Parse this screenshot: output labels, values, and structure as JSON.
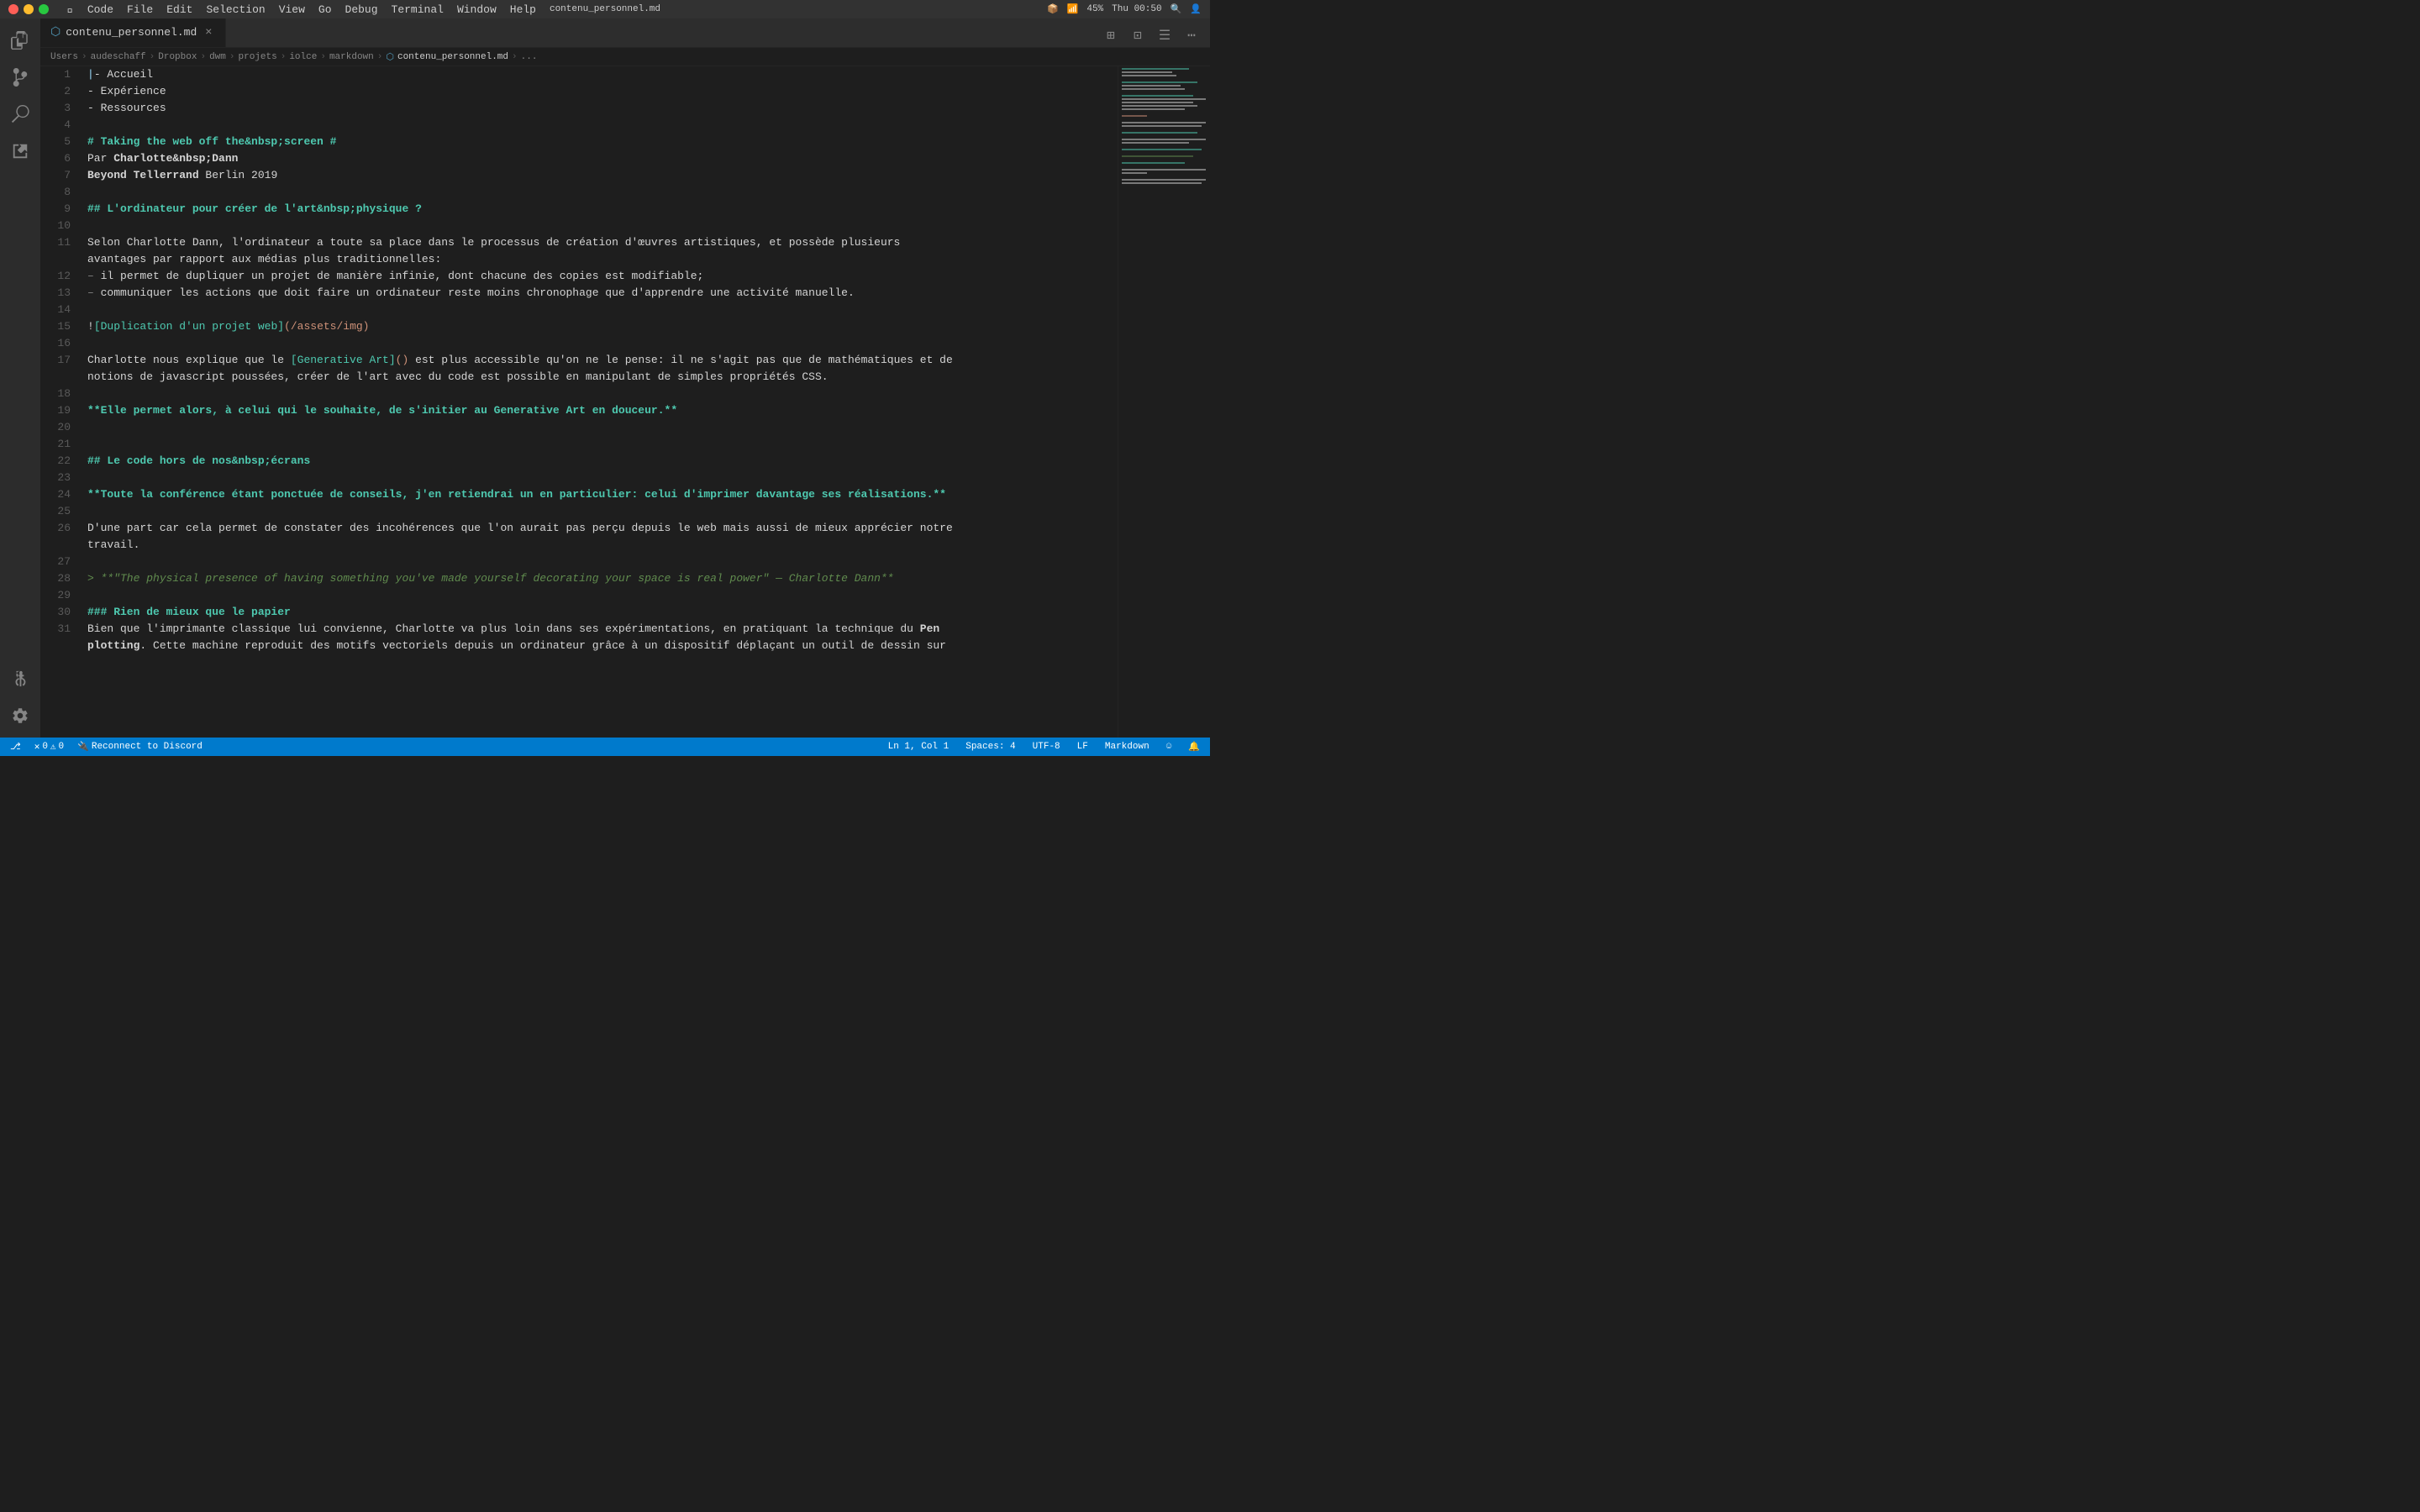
{
  "titlebar": {
    "title": "contenu_personnel.md",
    "menu_items": [
      "",
      "Code",
      "File",
      "Edit",
      "Selection",
      "View",
      "Go",
      "Debug",
      "Terminal",
      "Window",
      "Help"
    ]
  },
  "tab": {
    "name": "contenu_personnel.md",
    "icon": "📄"
  },
  "breadcrumb": {
    "items": [
      "Users",
      "audeschaff",
      "Dropbox",
      "dwm",
      "projets",
      "iolce",
      "markdown",
      "contenu_personnel.md",
      "..."
    ]
  },
  "lines": [
    {
      "num": 1,
      "tokens": [
        {
          "text": "|- Accueil",
          "class": ""
        }
      ]
    },
    {
      "num": 2,
      "tokens": [
        {
          "text": "- Expérience",
          "class": ""
        }
      ]
    },
    {
      "num": 3,
      "tokens": [
        {
          "text": "- Ressources",
          "class": ""
        }
      ]
    },
    {
      "num": 4,
      "tokens": [
        {
          "text": "",
          "class": ""
        }
      ]
    },
    {
      "num": 5,
      "tokens": [
        {
          "text": "# Taking the web off the&nbsp;screen #",
          "class": "c-heading"
        }
      ]
    },
    {
      "num": 6,
      "tokens": [
        {
          "text": "Par **Charlotte&nbsp;Dann**",
          "class": ""
        }
      ]
    },
    {
      "num": 7,
      "tokens": [
        {
          "text": "**Beyond Tellerrand** Berlin 2019",
          "class": ""
        }
      ]
    },
    {
      "num": 8,
      "tokens": [
        {
          "text": "",
          "class": ""
        }
      ]
    },
    {
      "num": 9,
      "tokens": [
        {
          "text": "## L'ordinateur pour créer de l'art&nbsp;physique ?",
          "class": "c-heading"
        }
      ]
    },
    {
      "num": 10,
      "tokens": [
        {
          "text": "",
          "class": ""
        }
      ]
    },
    {
      "num": 11,
      "tokens": [
        {
          "text": "Selon Charlotte Dann, l'ordinateur a toute sa place dans le processus de création d'œuvres artistiques, et possède plusieurs",
          "class": ""
        }
      ]
    },
    {
      "num": 11,
      "tokens2": [
        {
          "text": "avantages par rapport aux médias plus traditionnelles:",
          "class": ""
        }
      ]
    },
    {
      "num": 12,
      "tokens": [
        {
          "text": "- il permet de dupliquer un projet de manière infinie, dont chacune des copies est modifiable;",
          "class": ""
        }
      ]
    },
    {
      "num": 13,
      "tokens": [
        {
          "text": "- communiquer les actions que doit faire un ordinateur reste moins chronophage que d'apprendre une activité manuelle.",
          "class": ""
        }
      ]
    },
    {
      "num": 14,
      "tokens": [
        {
          "text": "",
          "class": ""
        }
      ]
    },
    {
      "num": 15,
      "tokens": [
        {
          "text": "![Duplication d'un projet web](/assets/img)",
          "class": ""
        }
      ]
    },
    {
      "num": 16,
      "tokens": [
        {
          "text": "",
          "class": ""
        }
      ]
    },
    {
      "num": 17,
      "tokens": [
        {
          "text": "Charlotte nous explique que le [Generative Art]() est plus accessible qu'on ne le pense: il ne s'agit pas que de mathématiques et de",
          "class": ""
        }
      ]
    },
    {
      "num": 17,
      "tokens2": [
        {
          "text": "notions de javascript poussées, créer de l'art avec du code est possible en manipulant de simples propriétés CSS.",
          "class": ""
        }
      ]
    },
    {
      "num": 18,
      "tokens": [
        {
          "text": "",
          "class": ""
        }
      ]
    },
    {
      "num": 19,
      "tokens": [
        {
          "text": "**Elle permet alors, à celui qui le souhaite, de s'initier au Generative Art en douceur.**",
          "class": "c-bold"
        }
      ]
    },
    {
      "num": 20,
      "tokens": [
        {
          "text": "",
          "class": ""
        }
      ]
    },
    {
      "num": 21,
      "tokens": [
        {
          "text": "",
          "class": ""
        }
      ]
    },
    {
      "num": 22,
      "tokens": [
        {
          "text": "## Le code hors de nos&nbsp;écrans",
          "class": "c-heading"
        }
      ]
    },
    {
      "num": 23,
      "tokens": [
        {
          "text": "",
          "class": ""
        }
      ]
    },
    {
      "num": 24,
      "tokens": [
        {
          "text": "**Toute la conférence étant ponctuée de conseils, j'en retiendrai un en particulier: celui d'imprimer davantage ses réalisations.**",
          "class": "c-bold"
        }
      ]
    },
    {
      "num": 25,
      "tokens": [
        {
          "text": "",
          "class": ""
        }
      ]
    },
    {
      "num": 26,
      "tokens": [
        {
          "text": "D'une part car cela permet de constater des incohérences que l'on aurait pas perçu depuis le web mais aussi de mieux apprécier notre",
          "class": ""
        }
      ]
    },
    {
      "num": 26,
      "tokens2": [
        {
          "text": "travail.",
          "class": ""
        }
      ]
    },
    {
      "num": 27,
      "tokens": [
        {
          "text": "",
          "class": ""
        }
      ]
    },
    {
      "num": 28,
      "tokens": [
        {
          "text": "> **\"The physical presence of having something you've made yourself decorating your space is real power\" — Charlotte Dann**",
          "class": "c-blockquote"
        }
      ]
    },
    {
      "num": 29,
      "tokens": [
        {
          "text": "",
          "class": ""
        }
      ]
    },
    {
      "num": 30,
      "tokens": [
        {
          "text": "### Rien de mieux que le papier",
          "class": "c-heading"
        }
      ]
    },
    {
      "num": 31,
      "tokens": [
        {
          "text": "Bien que l'imprimante classique lui convienne, Charlotte va plus loin dans ses expérimentations, en pratiquant la technique du **Pen",
          "class": ""
        }
      ]
    },
    {
      "num": 31,
      "tokens2": [
        {
          "text": "plotting**. Cette machine reproduit des motifs vectoriels depuis un ordinateur grâce à un dispositif déplaçant un outil de dessin sur",
          "class": ""
        }
      ]
    }
  ],
  "status_bar": {
    "errors": "0",
    "warnings": "0",
    "reconnect": "Reconnect to Discord",
    "position": "Ln 1, Col 1",
    "spaces": "Spaces: 4",
    "encoding": "UTF-8",
    "eol": "LF",
    "language": "Markdown",
    "battery": "45%",
    "time": "Thu 00:50"
  }
}
